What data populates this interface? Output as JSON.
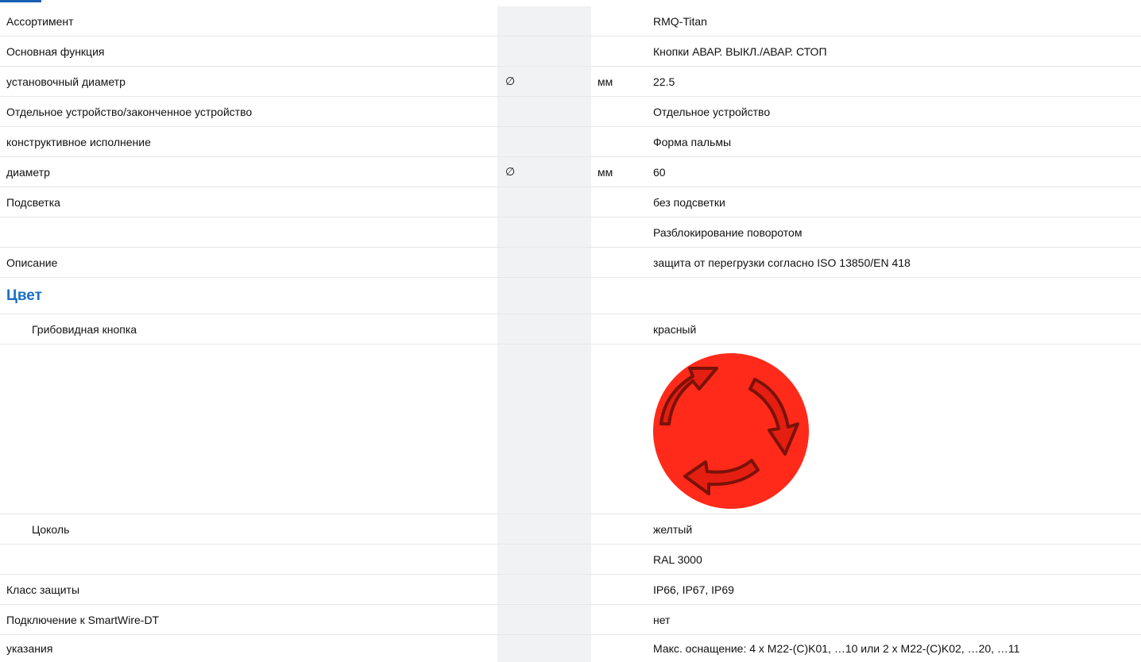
{
  "rows": [
    {
      "label": "Ассортимент",
      "value": "RMQ-Titan"
    },
    {
      "label": "Основная функция",
      "value": "Кнопки АВАР. ВЫКЛ./АВАР. СТОП"
    },
    {
      "label": "установочный диаметр",
      "symbol": "∅",
      "unit": "мм",
      "value": "22.5"
    },
    {
      "label": "Отдельное устройство/законченное устройство",
      "value": "Отдельное устройство"
    },
    {
      "label": "конструктивное исполнение",
      "value": "Форма пальмы"
    },
    {
      "label": "диаметр",
      "symbol": "∅",
      "unit": "мм",
      "value": "60"
    },
    {
      "label": "Подсветка",
      "value": "без подсветки"
    },
    {
      "label": "",
      "value": "Разблокирование поворотом"
    },
    {
      "label": "Описание",
      "value": "защита от перегрузки согласно ISO 13850/EN 418"
    },
    {
      "label": "Цвет",
      "value": ""
    },
    {
      "label": "Грибовидная кнопка",
      "value": "красный"
    },
    {
      "label": "",
      "value": ""
    },
    {
      "label": "Цоколь",
      "value": "желтый"
    },
    {
      "label": "",
      "value": "RAL 3000"
    },
    {
      "label": "Класс защиты",
      "value": "IP66, IP67, IP69"
    },
    {
      "label": "Подключение к SmartWire-DT",
      "value": "нет"
    },
    {
      "label": "указания",
      "value": "Макс. оснащение: 4 x M22-(C)K01, …10 или 2 x M22-(C)K02, …20, …11"
    }
  ],
  "colors": {
    "heading": "#1a6fc4",
    "button_red": "#ff2a1a",
    "arrow_stroke": "#7a1208",
    "shade": "#f1f2f3"
  },
  "icons": {
    "button_image": "red-mushroom-button-with-rotate-arrows"
  }
}
